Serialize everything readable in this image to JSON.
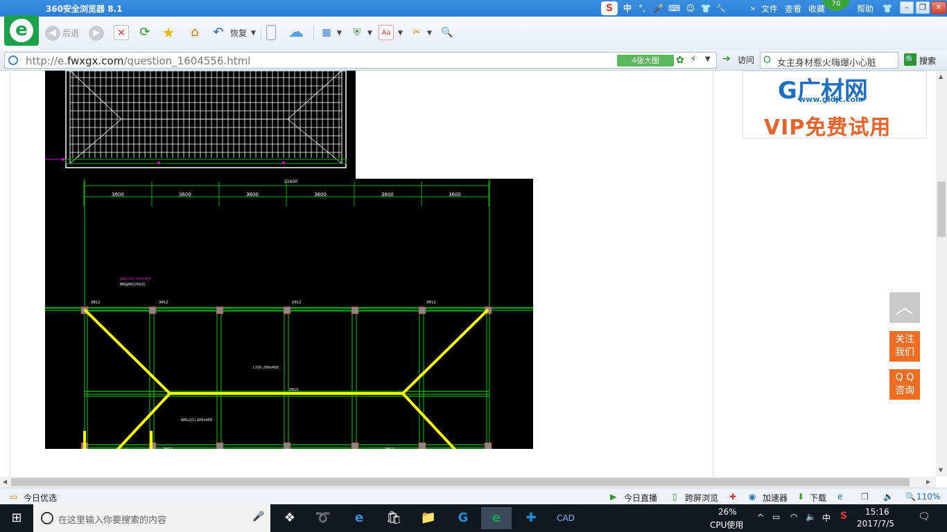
{
  "window": {
    "title": "360安全浏览器 8.1",
    "menus": [
      "文件",
      "查看",
      "收藏",
      "帮助"
    ],
    "ime": "中",
    "sogou_icon": "sogou-s-icon",
    "badge": "70"
  },
  "toolbar": {
    "back": "后退",
    "restore": "恢复"
  },
  "address": {
    "url_prefix": "http://e.",
    "url_domain": "fwxgx.com",
    "url_path": "/question_1604556.html",
    "bigpic": "4张大图",
    "visit": "访问",
    "search_text": "女主身材惹火嗨爆小心脏",
    "search_button": "搜索"
  },
  "ad": {
    "logo": "G广材网",
    "url": "www.gldjc.com",
    "slogan": "VIP免费试用"
  },
  "side": {
    "totop": "︿",
    "follow": "关注\n我们",
    "qq": "Q Q\n咨询"
  },
  "drawing": {
    "dim_labels": [
      "3600",
      "3600",
      "3600",
      "3600",
      "3600",
      "3600"
    ],
    "overall_dim": "21600",
    "colors": {
      "bg": "#000000",
      "grid": "#00b000",
      "hip": "#ffff00",
      "note": "#d000d0",
      "text": "#ffffff"
    }
  },
  "status": {
    "today_pick": "今日优选",
    "live": "今日直播",
    "cross_screen": "跨屏浏览",
    "accelerator": "加速器",
    "download": "下载",
    "zoom": "110%"
  },
  "taskbar": {
    "search_placeholder": "在这里输入你要搜索的内容",
    "cpu_pct": "26%",
    "cpu_label": "CPU使用",
    "ime": "中",
    "time": "15:16",
    "date": "2017/7/5"
  }
}
